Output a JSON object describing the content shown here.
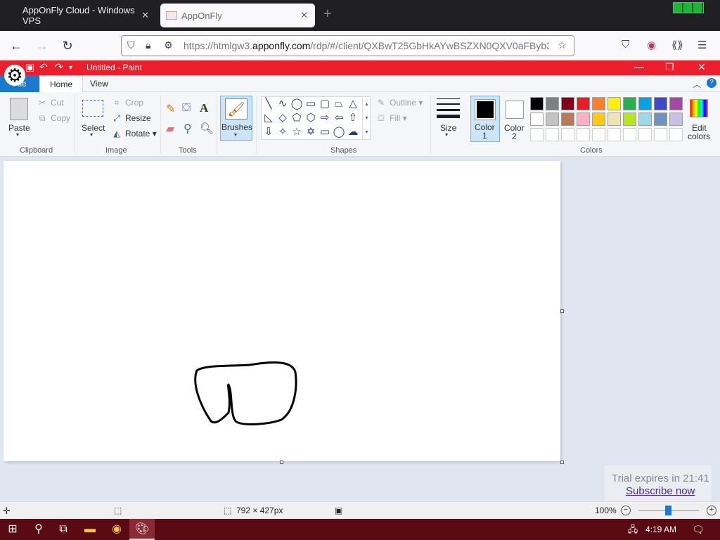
{
  "browser": {
    "tabs": [
      {
        "title": "AppOnFly Cloud - Windows VPS"
      },
      {
        "title": "AppOnFly"
      }
    ],
    "url_prefix": "https://htmlgw3.",
    "url_domain": "apponfly.com",
    "url_path": "/rdp/#/client/QXBwT25GbHkAYwBSZXN0QXV0aFByb3..."
  },
  "paint": {
    "window_title": "Untitled - Paint",
    "file_tab": "File",
    "tabs": {
      "home": "Home",
      "view": "View"
    },
    "clipboard": {
      "paste": "Paste",
      "cut": "Cut",
      "copy": "Copy",
      "label": "Clipboard"
    },
    "image": {
      "select": "Select",
      "crop": "Crop",
      "resize": "Resize",
      "rotate": "Rotate",
      "label": "Image"
    },
    "tools": {
      "label": "Tools"
    },
    "brushes": {
      "label": "Brushes"
    },
    "shapes": {
      "outline": "Outline",
      "fill": "Fill",
      "label": "Shapes"
    },
    "size": {
      "label": "Size"
    },
    "color1": {
      "label1": "Color",
      "label2": "1",
      "value": "#000000"
    },
    "color2": {
      "label1": "Color",
      "label2": "2",
      "value": "#ffffff"
    },
    "colors": {
      "label": "Colors",
      "edit_label1": "Edit",
      "edit_label2": "colors",
      "row1": [
        "#000000",
        "#7f7f7f",
        "#880015",
        "#ed1c24",
        "#ff7f27",
        "#fff200",
        "#22b14c",
        "#00a2e8",
        "#3f48cc",
        "#a349a4"
      ],
      "row2": [
        "#ffffff",
        "#c3c3c3",
        "#b97a57",
        "#ffaec9",
        "#ffc90e",
        "#efe4b0",
        "#b5e61d",
        "#99d9ea",
        "#7092be",
        "#c8bfe7"
      ]
    },
    "status": {
      "dimensions": "792 × 427px",
      "zoom": "100%"
    }
  },
  "trial": {
    "text": "Trial expires in 21:41",
    "link": "Subscribe now"
  },
  "taskbar": {
    "time": "4:19 AM"
  }
}
